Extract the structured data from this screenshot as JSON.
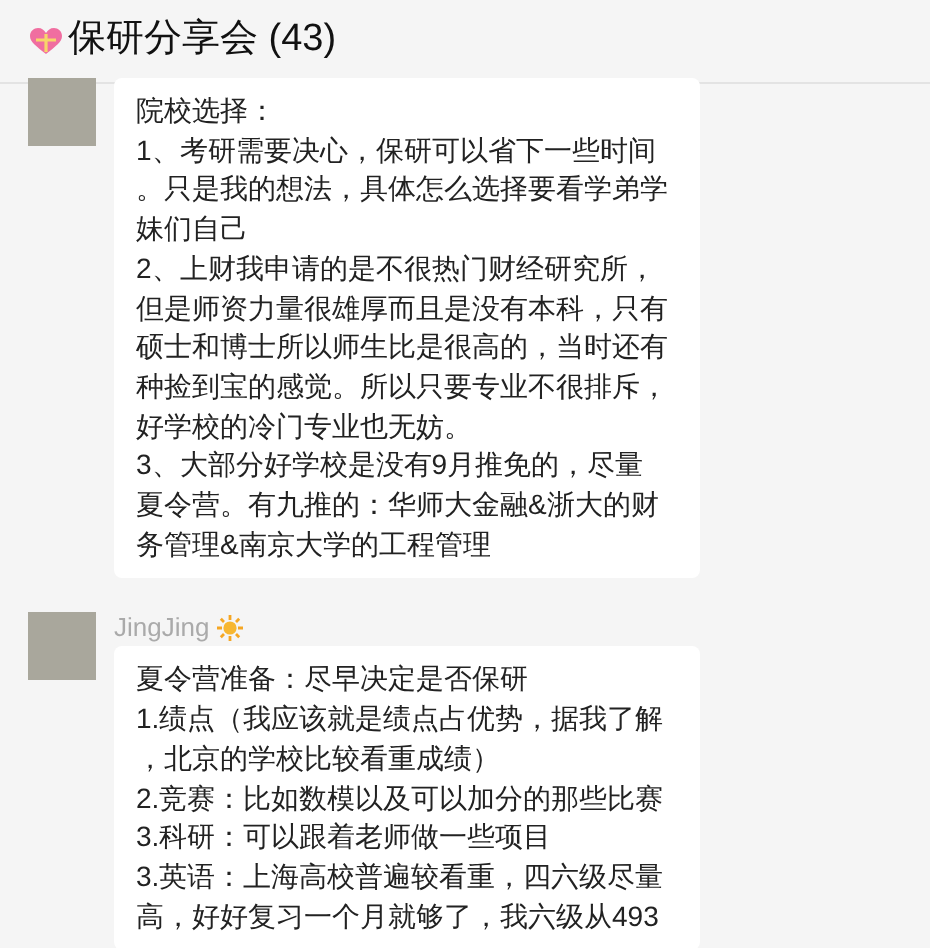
{
  "window": {
    "title": "保研分享会 (43)"
  },
  "messages": [
    {
      "lines": [
        "院校选择：",
        "1、考研需要决心，保研可以省下一些时间",
        "。只是我的想法，具体怎么选择要看学弟学",
        "妹们自己",
        "2、上财我申请的是不很热门财经研究所，",
        "但是师资力量很雄厚而且是没有本科，只有",
        "硕士和博士所以师生比是很高的，当时还有",
        "种捡到宝的感觉。所以只要专业不很排斥，",
        "好学校的冷门专业也无妨。",
        "3、大部分好学校是没有9月推免的，尽量",
        "夏令营。有九推的：华师大金融&浙大的财",
        "务管理&南京大学的工程管理"
      ]
    },
    {
      "sender": "JingJing",
      "lines": [
        "夏令营准备：尽早决定是否保研",
        "1.绩点（我应该就是绩点占优势，据我了解",
        "，北京的学校比较看重成绩）",
        "2.竞赛：比如数模以及可以加分的那些比赛",
        "3.科研：可以跟着老师做一些项目",
        "3.英语：上海高校普遍较看重，四六级尽量",
        "高，好好复习一个月就够了，我六级从493"
      ]
    }
  ]
}
